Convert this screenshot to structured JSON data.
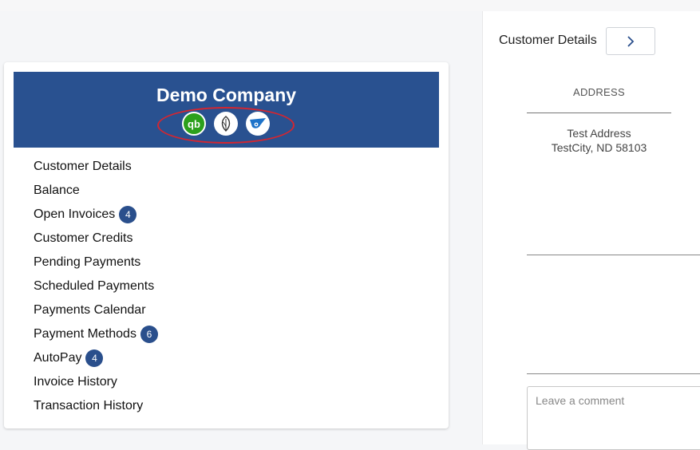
{
  "company": {
    "name": "Demo Company"
  },
  "integrations": [
    {
      "name": "quickbooks-icon",
      "glyph": "qb"
    },
    {
      "name": "leaf-icon"
    },
    {
      "name": "bird-icon"
    }
  ],
  "menu": [
    {
      "label": "Customer Details"
    },
    {
      "label": "Balance"
    },
    {
      "label": "Open Invoices",
      "badge": "4"
    },
    {
      "label": "Customer Credits"
    },
    {
      "label": "Pending Payments"
    },
    {
      "label": "Scheduled Payments"
    },
    {
      "label": "Payments Calendar"
    },
    {
      "label": "Payment Methods",
      "badge": "6"
    },
    {
      "label": "AutoPay",
      "badge": "4"
    },
    {
      "label": "Invoice History"
    },
    {
      "label": "Transaction History"
    }
  ],
  "panel": {
    "title": "Customer Details",
    "next_icon": "chevron-right-icon",
    "address_header": "ADDRESS",
    "address_line1": "Test Address",
    "address_line2": "TestCity, ND 58103",
    "comment_placeholder": "Leave a comment"
  },
  "colors": {
    "banner": "#295190",
    "badge": "#2a4f8c",
    "highlight": "#d42630",
    "quickbooks": "#2ca01c"
  }
}
